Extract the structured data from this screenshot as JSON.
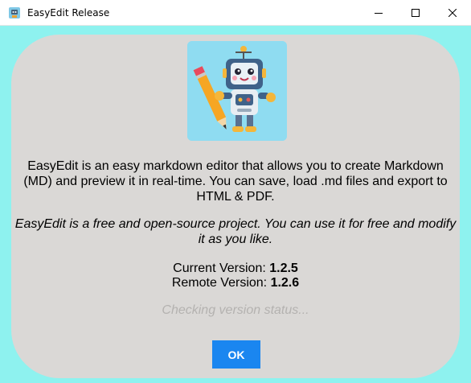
{
  "window": {
    "title": "EasyEdit Release"
  },
  "dialog": {
    "description_lines": [
      "EasyEdit is an easy markdown editor that allows you to create Markdown",
      "(MD) and preview it in real-time. You can save, load .md files and export to",
      "HTML & PDF."
    ],
    "note_lines": [
      "EasyEdit is a free and open-source project. You can use it for free and modify",
      "it as you like."
    ],
    "current_version_label": "Current Version: ",
    "current_version": "1.2.5",
    "remote_version_label": "Remote Version: ",
    "remote_version": "1.2.6",
    "status": "Checking version status...",
    "ok_label": "OK"
  },
  "colors": {
    "background": "#8ef2ef",
    "card": "#dad8d6",
    "ok_button": "#1a86f0"
  },
  "icons": [
    "app-icon",
    "minimize-icon",
    "maximize-icon",
    "close-icon",
    "robot-logo"
  ]
}
